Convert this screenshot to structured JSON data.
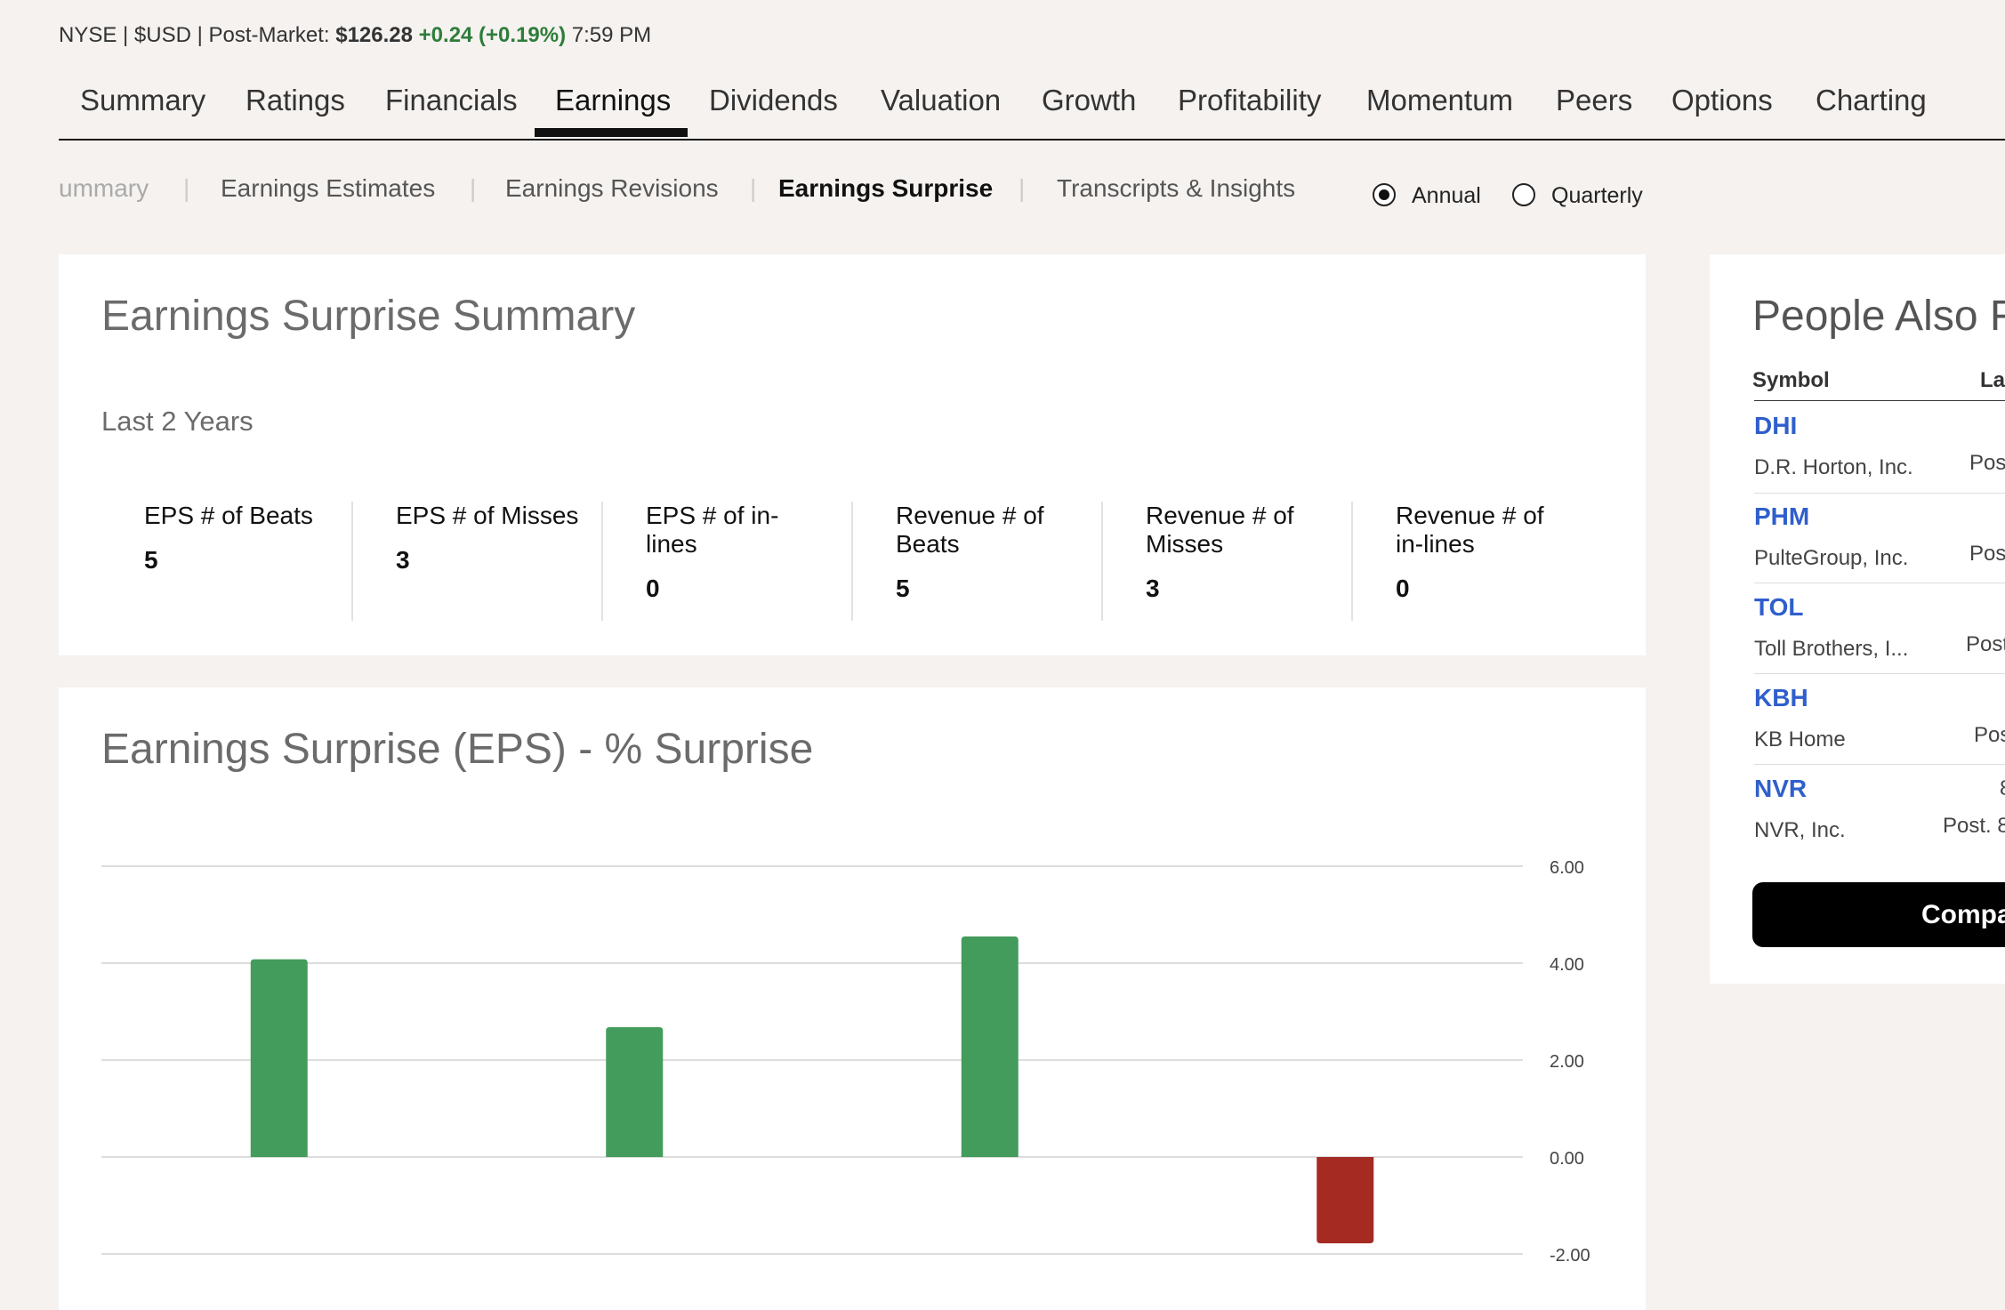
{
  "ticker": {
    "exchange_line": "NYSE | $USD | Post-Market:",
    "price": "$126.28",
    "change": "+0.24 (+0.19%)",
    "time": "7:59 PM",
    "up_color": "#2e7d3a"
  },
  "main_tabs": [
    "Summary",
    "Ratings",
    "Financials",
    "Earnings",
    "Dividends",
    "Valuation",
    "Growth",
    "Profitability",
    "Momentum",
    "Peers",
    "Options",
    "Charting"
  ],
  "main_tabs_active": "Earnings",
  "sub_tabs": [
    "ummary",
    "Earnings Estimates",
    "Earnings Revisions",
    "Earnings Surprise",
    "Transcripts & Insights"
  ],
  "sub_tabs_active": "Earnings Surprise",
  "period_options": [
    "Annual",
    "Quarterly"
  ],
  "period_selected": "Annual",
  "summary_card": {
    "title": "Earnings Surprise Summary",
    "period": "Last 2 Years",
    "stats": [
      {
        "label": "EPS # of Beats",
        "value": "5"
      },
      {
        "label": "EPS # of Misses",
        "value": "3"
      },
      {
        "label": "EPS # of in-lines",
        "value": "0"
      },
      {
        "label": "Revenue # of Beats",
        "value": "5"
      },
      {
        "label": "Revenue # of Misses",
        "value": "3"
      },
      {
        "label": "Revenue # of in-lines",
        "value": "0"
      }
    ]
  },
  "chart_card": {
    "title": "Earnings Surprise (EPS) - % Surprise"
  },
  "chart_data": {
    "type": "bar",
    "title": "Earnings Surprise (EPS) - % Surprise",
    "values": [
      4.08,
      2.68,
      4.55,
      -1.78
    ],
    "y_ticks": [
      "6.00",
      "4.00",
      "2.00",
      "0.00",
      "-2.00"
    ],
    "ylim": [
      -2,
      6
    ],
    "grid": true,
    "positive_color": "#449c5c",
    "negative_color": "#a52a22"
  },
  "peers": {
    "title": "People Also Fo",
    "col_symbol": "Symbol",
    "col_last": "La",
    "rows": [
      {
        "symbol": "DHI",
        "name": "D.R. Horton, Inc.",
        "post": "Pos"
      },
      {
        "symbol": "PHM",
        "name": "PulteGroup, Inc.",
        "post": "Pos"
      },
      {
        "symbol": "TOL",
        "name": "Toll Brothers, I...",
        "post": "Post"
      },
      {
        "symbol": "KBH",
        "name": "KB Home",
        "post": "Pos"
      },
      {
        "symbol": "NVR",
        "name": "NVR, Inc.",
        "post": "Post. 8",
        "price": "8"
      }
    ],
    "compare_label": "Compa",
    "link_color": "#2f5fcc"
  }
}
